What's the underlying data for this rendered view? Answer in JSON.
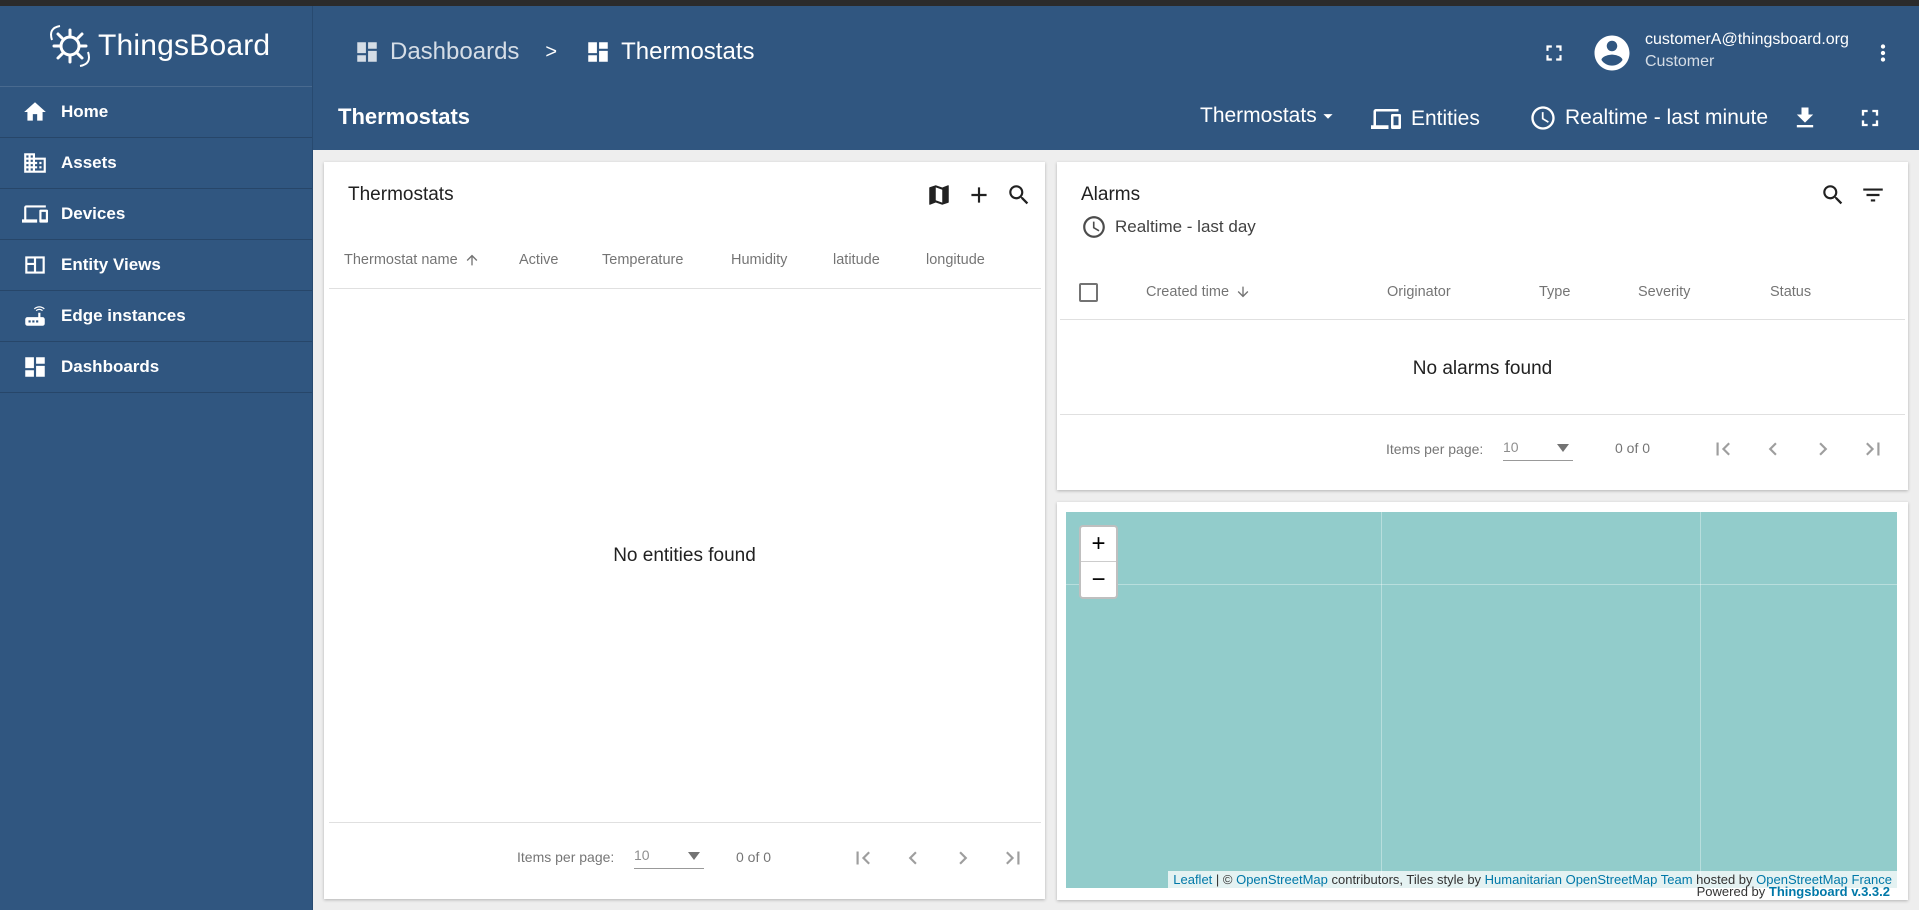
{
  "app": {
    "name": "ThingsBoard"
  },
  "sidebar": {
    "items": [
      {
        "label": "Home",
        "icon": "home-icon"
      },
      {
        "label": "Assets",
        "icon": "assets-icon"
      },
      {
        "label": "Devices",
        "icon": "devices-icon"
      },
      {
        "label": "Entity Views",
        "icon": "entity-views-icon"
      },
      {
        "label": "Edge instances",
        "icon": "router-icon"
      },
      {
        "label": "Dashboards",
        "icon": "dashboard-icon"
      }
    ]
  },
  "header": {
    "breadcrumb": [
      "Dashboards",
      ">",
      "Thermostats"
    ],
    "user_email": "customerA@thingsboard.org",
    "user_role": "Customer"
  },
  "toolbar": {
    "title": "Thermostats",
    "state_select": "Thermostats",
    "entities_label": "Entities",
    "timewindow": "Realtime - last minute"
  },
  "thermostats_widget": {
    "title": "Thermostats",
    "columns": [
      "Thermostat name",
      "Active",
      "Temperature",
      "Humidity",
      "latitude",
      "longitude"
    ],
    "empty_message": "No entities found",
    "items_per_page_label": "Items per page:",
    "items_per_page": "10",
    "range": "0 of 0"
  },
  "alarms_widget": {
    "title": "Alarms",
    "timewindow": "Realtime - last day",
    "columns": [
      "Created time",
      "Originator",
      "Type",
      "Severity",
      "Status"
    ],
    "empty_message": "No alarms found",
    "items_per_page_label": "Items per page:",
    "items_per_page": "10",
    "range": "0 of 0"
  },
  "map_widget": {
    "zoom_in": "+",
    "zoom_out": "−",
    "attribution": {
      "leaflet": "Leaflet",
      "sep": " | © ",
      "osm": "OpenStreetMap",
      "contrib": " contributors, Tiles style by ",
      "hot": "Humanitarian OpenStreetMap Team",
      "hosted": " hosted by ",
      "osm_fr": "OpenStreetMap France"
    },
    "powered_prefix": "Powered by ",
    "powered_link": "Thingsboard v.3.3.2"
  },
  "colors": {
    "primary": "#305680",
    "map_water": "#92cccb",
    "content_bg": "#eeeeee",
    "link": "#0078a8"
  }
}
